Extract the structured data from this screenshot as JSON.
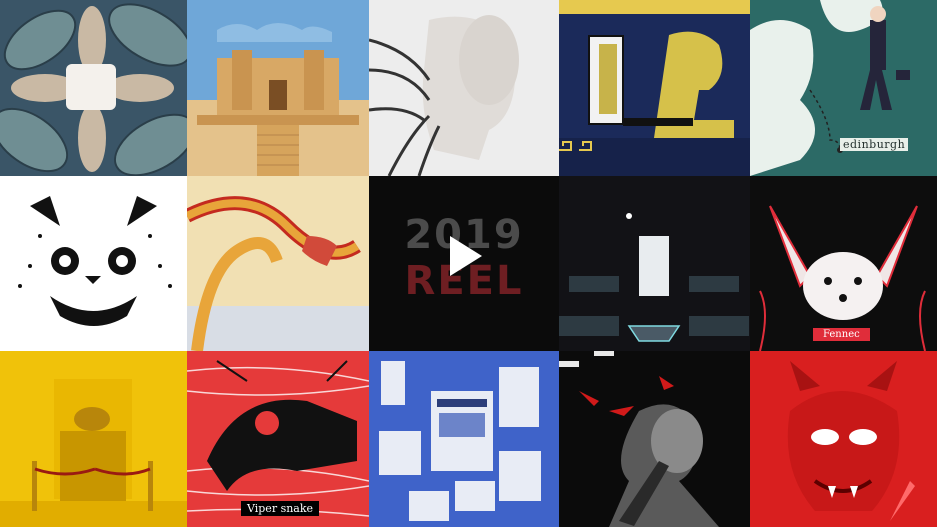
{
  "reel": {
    "year_text": "2019",
    "title_text": "REEL",
    "play_icon": "play-icon"
  },
  "captions": {
    "edinburgh": "edinburgh",
    "viper": "Viper snake",
    "fennec": "Fennec"
  },
  "colors": {
    "background": "#000000",
    "reel_year": "#4b4b4b",
    "reel_word": "#6e1e22",
    "accent_red": "#e02d3a",
    "accent_yellow": "#f0c20a"
  }
}
